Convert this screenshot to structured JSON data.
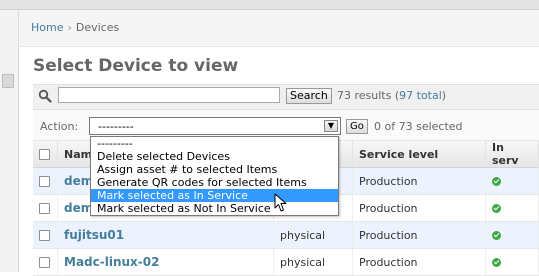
{
  "breadcrumb": {
    "home": "Home",
    "separator": "›",
    "current": "Devices"
  },
  "page_title": "Select Device to view",
  "search": {
    "value": "",
    "button_label": "Search",
    "results_text": "73 results (",
    "total_link": "97 total",
    "results_suffix": ")"
  },
  "action": {
    "label": "Action:",
    "selected": "---------",
    "go_label": "Go",
    "selected_count": "0 of 73 selected",
    "options": [
      "---------",
      "Delete selected Devices",
      "Assign asset # to selected Items",
      "Generate QR codes for selected Items",
      "Mark selected as In Service",
      "Mark selected as Not In Service"
    ],
    "highlighted_index": 4
  },
  "table": {
    "columns": [
      "Nam",
      "",
      "Service level",
      "In serv"
    ],
    "rows": [
      {
        "name": "dem",
        "type": "",
        "service_level": "Production",
        "in_service": true
      },
      {
        "name": "dem",
        "type": "",
        "service_level": "Production",
        "in_service": true
      },
      {
        "name": "fujitsu01",
        "type": "physical",
        "service_level": "Production",
        "in_service": true
      },
      {
        "name": "Madc-linux-02",
        "type": "physical",
        "service_level": "Production",
        "in_service": true
      }
    ]
  },
  "colors": {
    "link": "#447e9b",
    "highlight": "#3399ff",
    "alt_row": "#edf3fe",
    "ok": "#3fa745"
  }
}
